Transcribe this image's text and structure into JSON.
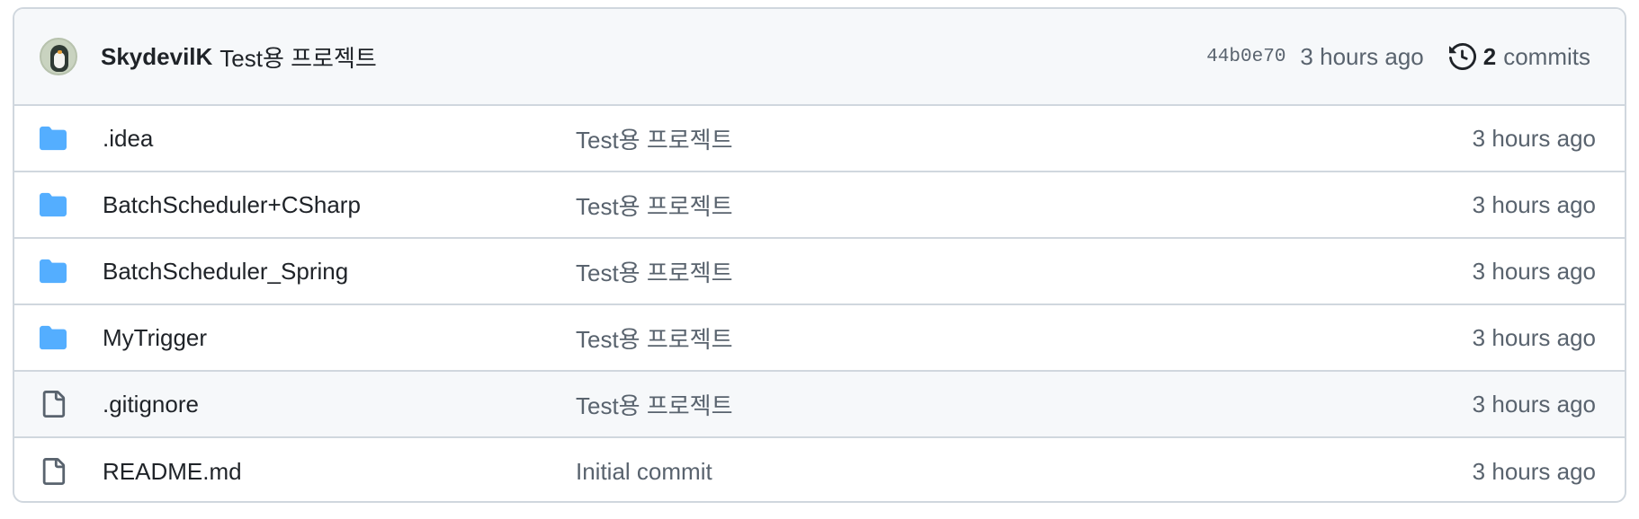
{
  "header": {
    "author": "SkydevilK",
    "commit_message": "Test용 프로젝트",
    "sha": "44b0e70",
    "time": "3 hours ago",
    "commits_count": "2",
    "commits_label": "commits"
  },
  "colors": {
    "folder": "#54aeff",
    "file_icon": "#59636e",
    "border": "#d0d7de",
    "header_bg": "#f6f8fa",
    "muted_text": "#59636e"
  },
  "rows": [
    {
      "type": "folder",
      "icon": "folder-icon",
      "name": ".idea",
      "message": "Test용 프로젝트",
      "age": "3 hours ago"
    },
    {
      "type": "folder",
      "icon": "folder-icon",
      "name": "BatchScheduler+CSharp",
      "message": "Test용 프로젝트",
      "age": "3 hours ago"
    },
    {
      "type": "folder",
      "icon": "folder-icon",
      "name": "BatchScheduler_Spring",
      "message": "Test용 프로젝트",
      "age": "3 hours ago"
    },
    {
      "type": "folder",
      "icon": "folder-icon",
      "name": "MyTrigger",
      "message": "Test용 프로젝트",
      "age": "3 hours ago"
    },
    {
      "type": "file",
      "icon": "file-icon",
      "name": ".gitignore",
      "message": "Test용 프로젝트",
      "age": "3 hours ago"
    },
    {
      "type": "file",
      "icon": "file-icon",
      "name": "README.md",
      "message": "Initial commit",
      "age": "3 hours ago"
    }
  ]
}
